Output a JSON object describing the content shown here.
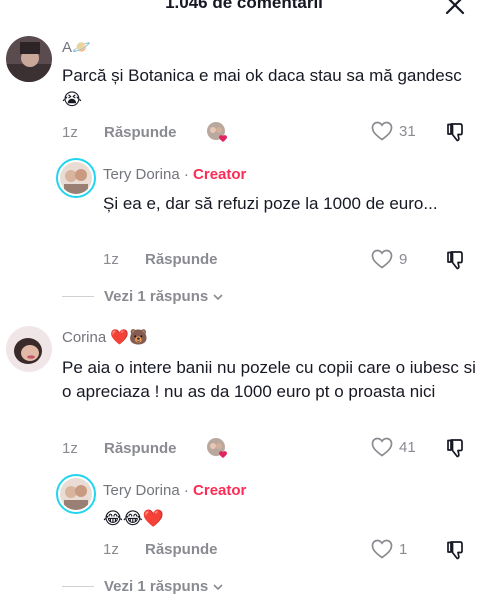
{
  "header": {
    "title": "1.046 de comentarii"
  },
  "comments": [
    {
      "username": "A🪐",
      "text": "Parcă și Botanica e mai ok daca stau sa mă gandesc😭",
      "time": "1z",
      "reply_label": "Răspunde",
      "likes": "31",
      "reply": {
        "username": "Tery Dorina",
        "separator": "·",
        "creator_label": "Creator",
        "text": "Și ea e, dar să refuzi poze la 1000 de euro...",
        "time": "1z",
        "reply_label": "Răspunde",
        "likes": "9"
      },
      "view_replies": "Vezi 1 răspuns"
    },
    {
      "username": "Corina ❤️🐻",
      "text": "Pe aia o intere banii nu pozele cu copii care o iubesc si o apreciaza ! nu as da 1000 euro pt o proasta nici",
      "time": "1z",
      "reply_label": "Răspunde",
      "likes": "41",
      "reply": {
        "username": "Tery Dorina",
        "separator": "·",
        "creator_label": "Creator",
        "text": "😂😂❤️",
        "time": "1z",
        "reply_label": "Răspunde",
        "likes": "1"
      },
      "view_replies": "Vezi 1 răspuns"
    }
  ],
  "colors": {
    "creator": "#fe2c55",
    "ring": "#20d5ec",
    "meta": "#8a8b91",
    "heart": "#e0245e"
  }
}
